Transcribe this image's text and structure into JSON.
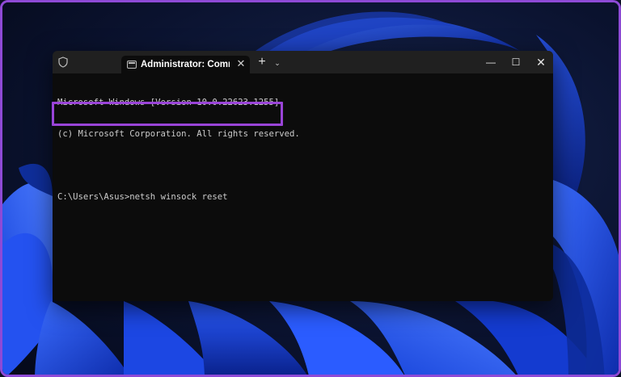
{
  "window": {
    "tab_title": "Administrator: Command Prompt",
    "tab_close": "✕",
    "new_tab": "+",
    "dropdown": "⌄",
    "minimize": "—",
    "maximize": "☐",
    "close": "✕"
  },
  "console": {
    "lines": [
      "Microsoft Windows [Version 10.0.22623.1255]",
      "(c) Microsoft Corporation. All rights reserved."
    ],
    "prompt": "C:\\Users\\Asus>",
    "command": "netsh winsock reset"
  },
  "icons": {
    "shield": "shield-icon",
    "tab": "terminal-tab-icon"
  },
  "colors": {
    "highlight_border": "#9a44d8",
    "frame_border": "#8e4ad6",
    "terminal_bg": "#0c0c0c",
    "titlebar_bg": "#202020",
    "text": "#cccccc",
    "wallpaper_blue": "#1f4fe0"
  }
}
